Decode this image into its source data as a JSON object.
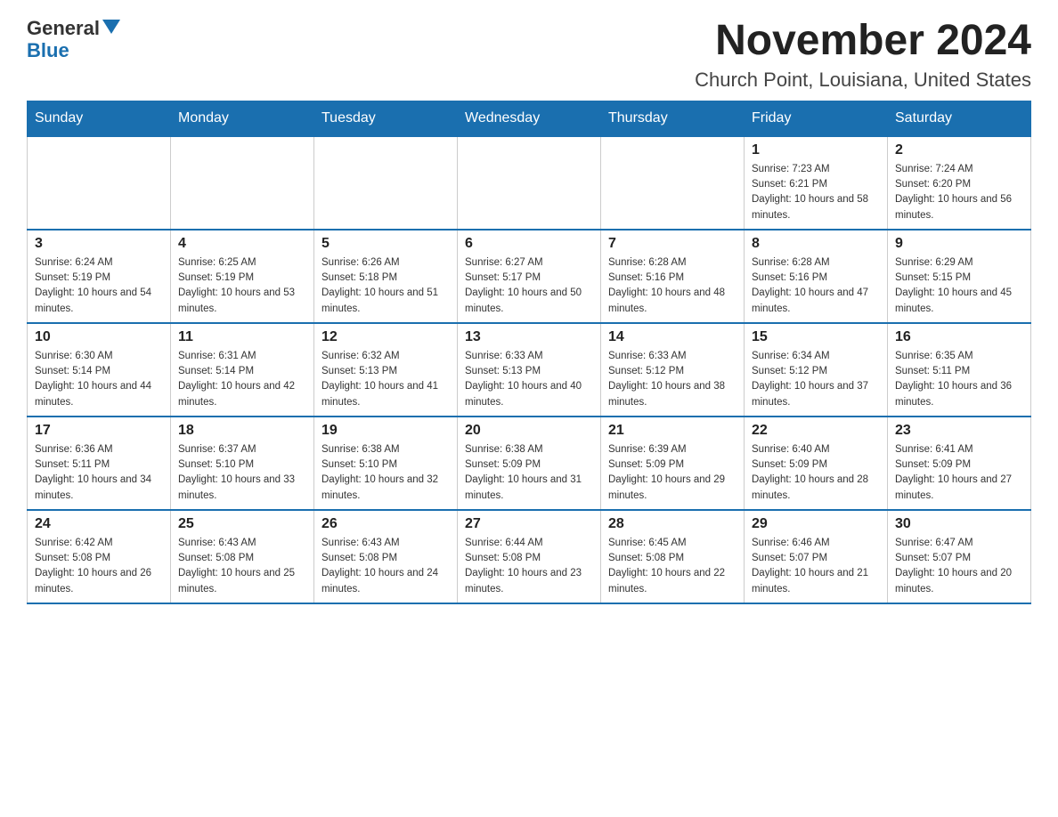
{
  "header": {
    "logo_general": "General",
    "logo_blue": "Blue",
    "title": "November 2024",
    "subtitle": "Church Point, Louisiana, United States"
  },
  "weekdays": [
    "Sunday",
    "Monday",
    "Tuesday",
    "Wednesday",
    "Thursday",
    "Friday",
    "Saturday"
  ],
  "weeks": [
    [
      {
        "day": "",
        "sunrise": "",
        "sunset": "",
        "daylight": "",
        "empty": true
      },
      {
        "day": "",
        "sunrise": "",
        "sunset": "",
        "daylight": "",
        "empty": true
      },
      {
        "day": "",
        "sunrise": "",
        "sunset": "",
        "daylight": "",
        "empty": true
      },
      {
        "day": "",
        "sunrise": "",
        "sunset": "",
        "daylight": "",
        "empty": true
      },
      {
        "day": "",
        "sunrise": "",
        "sunset": "",
        "daylight": "",
        "empty": true
      },
      {
        "day": "1",
        "sunrise": "Sunrise: 7:23 AM",
        "sunset": "Sunset: 6:21 PM",
        "daylight": "Daylight: 10 hours and 58 minutes.",
        "empty": false
      },
      {
        "day": "2",
        "sunrise": "Sunrise: 7:24 AM",
        "sunset": "Sunset: 6:20 PM",
        "daylight": "Daylight: 10 hours and 56 minutes.",
        "empty": false
      }
    ],
    [
      {
        "day": "3",
        "sunrise": "Sunrise: 6:24 AM",
        "sunset": "Sunset: 5:19 PM",
        "daylight": "Daylight: 10 hours and 54 minutes.",
        "empty": false
      },
      {
        "day": "4",
        "sunrise": "Sunrise: 6:25 AM",
        "sunset": "Sunset: 5:19 PM",
        "daylight": "Daylight: 10 hours and 53 minutes.",
        "empty": false
      },
      {
        "day": "5",
        "sunrise": "Sunrise: 6:26 AM",
        "sunset": "Sunset: 5:18 PM",
        "daylight": "Daylight: 10 hours and 51 minutes.",
        "empty": false
      },
      {
        "day": "6",
        "sunrise": "Sunrise: 6:27 AM",
        "sunset": "Sunset: 5:17 PM",
        "daylight": "Daylight: 10 hours and 50 minutes.",
        "empty": false
      },
      {
        "day": "7",
        "sunrise": "Sunrise: 6:28 AM",
        "sunset": "Sunset: 5:16 PM",
        "daylight": "Daylight: 10 hours and 48 minutes.",
        "empty": false
      },
      {
        "day": "8",
        "sunrise": "Sunrise: 6:28 AM",
        "sunset": "Sunset: 5:16 PM",
        "daylight": "Daylight: 10 hours and 47 minutes.",
        "empty": false
      },
      {
        "day": "9",
        "sunrise": "Sunrise: 6:29 AM",
        "sunset": "Sunset: 5:15 PM",
        "daylight": "Daylight: 10 hours and 45 minutes.",
        "empty": false
      }
    ],
    [
      {
        "day": "10",
        "sunrise": "Sunrise: 6:30 AM",
        "sunset": "Sunset: 5:14 PM",
        "daylight": "Daylight: 10 hours and 44 minutes.",
        "empty": false
      },
      {
        "day": "11",
        "sunrise": "Sunrise: 6:31 AM",
        "sunset": "Sunset: 5:14 PM",
        "daylight": "Daylight: 10 hours and 42 minutes.",
        "empty": false
      },
      {
        "day": "12",
        "sunrise": "Sunrise: 6:32 AM",
        "sunset": "Sunset: 5:13 PM",
        "daylight": "Daylight: 10 hours and 41 minutes.",
        "empty": false
      },
      {
        "day": "13",
        "sunrise": "Sunrise: 6:33 AM",
        "sunset": "Sunset: 5:13 PM",
        "daylight": "Daylight: 10 hours and 40 minutes.",
        "empty": false
      },
      {
        "day": "14",
        "sunrise": "Sunrise: 6:33 AM",
        "sunset": "Sunset: 5:12 PM",
        "daylight": "Daylight: 10 hours and 38 minutes.",
        "empty": false
      },
      {
        "day": "15",
        "sunrise": "Sunrise: 6:34 AM",
        "sunset": "Sunset: 5:12 PM",
        "daylight": "Daylight: 10 hours and 37 minutes.",
        "empty": false
      },
      {
        "day": "16",
        "sunrise": "Sunrise: 6:35 AM",
        "sunset": "Sunset: 5:11 PM",
        "daylight": "Daylight: 10 hours and 36 minutes.",
        "empty": false
      }
    ],
    [
      {
        "day": "17",
        "sunrise": "Sunrise: 6:36 AM",
        "sunset": "Sunset: 5:11 PM",
        "daylight": "Daylight: 10 hours and 34 minutes.",
        "empty": false
      },
      {
        "day": "18",
        "sunrise": "Sunrise: 6:37 AM",
        "sunset": "Sunset: 5:10 PM",
        "daylight": "Daylight: 10 hours and 33 minutes.",
        "empty": false
      },
      {
        "day": "19",
        "sunrise": "Sunrise: 6:38 AM",
        "sunset": "Sunset: 5:10 PM",
        "daylight": "Daylight: 10 hours and 32 minutes.",
        "empty": false
      },
      {
        "day": "20",
        "sunrise": "Sunrise: 6:38 AM",
        "sunset": "Sunset: 5:09 PM",
        "daylight": "Daylight: 10 hours and 31 minutes.",
        "empty": false
      },
      {
        "day": "21",
        "sunrise": "Sunrise: 6:39 AM",
        "sunset": "Sunset: 5:09 PM",
        "daylight": "Daylight: 10 hours and 29 minutes.",
        "empty": false
      },
      {
        "day": "22",
        "sunrise": "Sunrise: 6:40 AM",
        "sunset": "Sunset: 5:09 PM",
        "daylight": "Daylight: 10 hours and 28 minutes.",
        "empty": false
      },
      {
        "day": "23",
        "sunrise": "Sunrise: 6:41 AM",
        "sunset": "Sunset: 5:09 PM",
        "daylight": "Daylight: 10 hours and 27 minutes.",
        "empty": false
      }
    ],
    [
      {
        "day": "24",
        "sunrise": "Sunrise: 6:42 AM",
        "sunset": "Sunset: 5:08 PM",
        "daylight": "Daylight: 10 hours and 26 minutes.",
        "empty": false
      },
      {
        "day": "25",
        "sunrise": "Sunrise: 6:43 AM",
        "sunset": "Sunset: 5:08 PM",
        "daylight": "Daylight: 10 hours and 25 minutes.",
        "empty": false
      },
      {
        "day": "26",
        "sunrise": "Sunrise: 6:43 AM",
        "sunset": "Sunset: 5:08 PM",
        "daylight": "Daylight: 10 hours and 24 minutes.",
        "empty": false
      },
      {
        "day": "27",
        "sunrise": "Sunrise: 6:44 AM",
        "sunset": "Sunset: 5:08 PM",
        "daylight": "Daylight: 10 hours and 23 minutes.",
        "empty": false
      },
      {
        "day": "28",
        "sunrise": "Sunrise: 6:45 AM",
        "sunset": "Sunset: 5:08 PM",
        "daylight": "Daylight: 10 hours and 22 minutes.",
        "empty": false
      },
      {
        "day": "29",
        "sunrise": "Sunrise: 6:46 AM",
        "sunset": "Sunset: 5:07 PM",
        "daylight": "Daylight: 10 hours and 21 minutes.",
        "empty": false
      },
      {
        "day": "30",
        "sunrise": "Sunrise: 6:47 AM",
        "sunset": "Sunset: 5:07 PM",
        "daylight": "Daylight: 10 hours and 20 minutes.",
        "empty": false
      }
    ]
  ]
}
